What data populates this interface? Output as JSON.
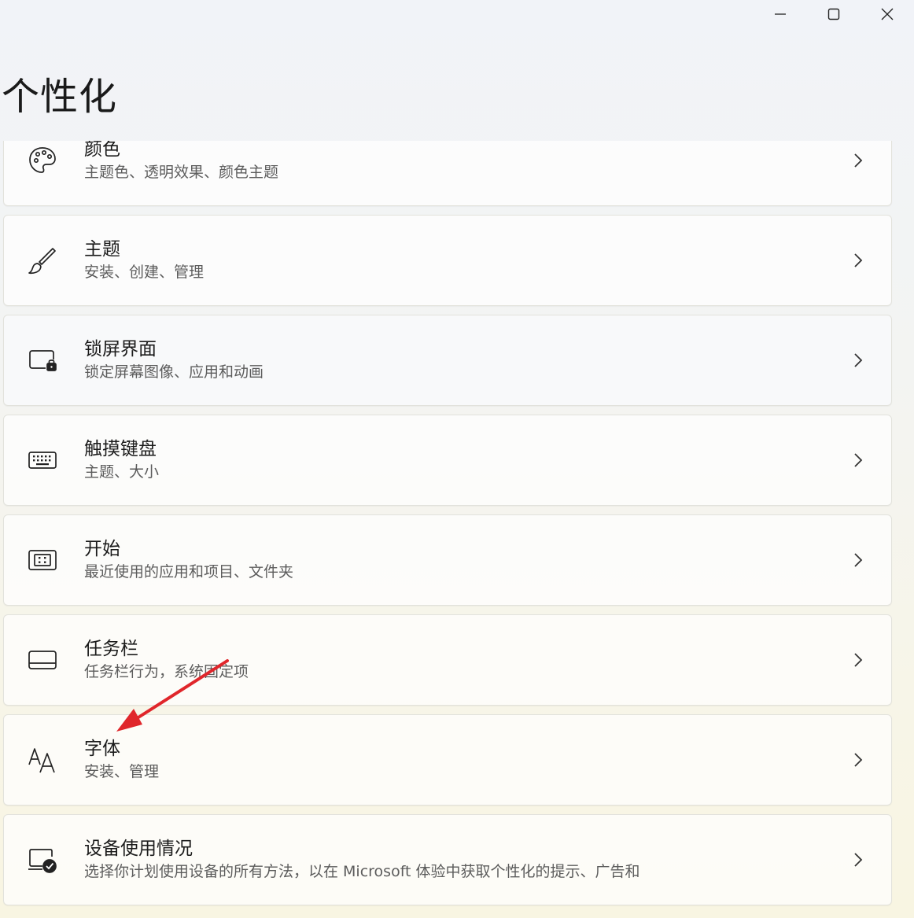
{
  "page": {
    "title": "个性化"
  },
  "window_controls": {
    "minimize_icon": "minimize-icon",
    "maximize_icon": "maximize-icon",
    "close_icon": "close-icon"
  },
  "items": [
    {
      "title": "颜色",
      "subtitle": "主题色、透明效果、颜色主题",
      "icon": "palette-icon"
    },
    {
      "title": "主题",
      "subtitle": "安装、创建、管理",
      "icon": "brush-icon"
    },
    {
      "title": "锁屏界面",
      "subtitle": "锁定屏幕图像、应用和动画",
      "icon": "lock-screen-icon"
    },
    {
      "title": "触摸键盘",
      "subtitle": "主题、大小",
      "icon": "keyboard-icon"
    },
    {
      "title": "开始",
      "subtitle": "最近使用的应用和项目、文件夹",
      "icon": "start-icon"
    },
    {
      "title": "任务栏",
      "subtitle": "任务栏行为，系统固定项",
      "icon": "taskbar-icon"
    },
    {
      "title": "字体",
      "subtitle": "安装、管理",
      "icon": "font-icon"
    },
    {
      "title": "设备使用情况",
      "subtitle": "选择你计划使用设备的所有方法，以在 Microsoft 体验中获取个性化的提示、广告和",
      "icon": "device-usage-icon"
    }
  ],
  "colors": {
    "accent_arrow": "#e0262b"
  }
}
